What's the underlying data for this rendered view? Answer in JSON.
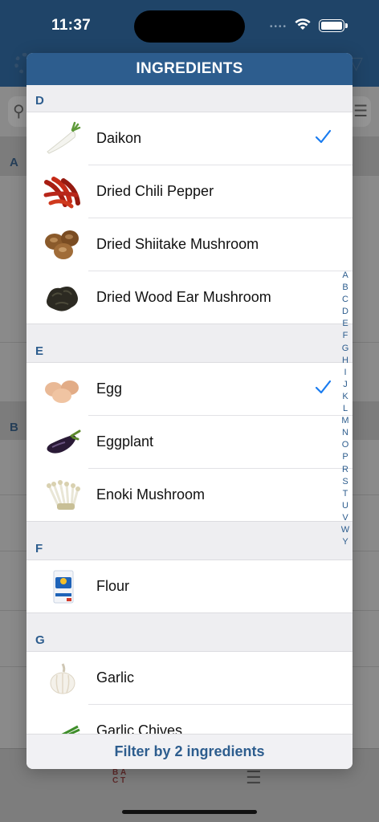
{
  "status": {
    "time": "11:37"
  },
  "background": {
    "sections": [
      "A",
      "B"
    ],
    "tabbar": {
      "abc_icon": "abc-sort-icon",
      "filter_icon": "sliders-icon"
    }
  },
  "modal": {
    "title": "INGREDIENTS",
    "footer_button": "Filter by 2 ingredients"
  },
  "sections": [
    {
      "letter": "D",
      "items": [
        {
          "label": "Daikon",
          "checked": true,
          "icon": "daikon"
        },
        {
          "label": "Dried Chili Pepper",
          "checked": false,
          "icon": "chili"
        },
        {
          "label": "Dried Shiitake Mushroom",
          "checked": false,
          "icon": "shiitake"
        },
        {
          "label": "Dried Wood Ear Mushroom",
          "checked": false,
          "icon": "woodear"
        }
      ]
    },
    {
      "letter": "E",
      "items": [
        {
          "label": "Egg",
          "checked": true,
          "icon": "egg"
        },
        {
          "label": "Eggplant",
          "checked": false,
          "icon": "eggplant"
        },
        {
          "label": "Enoki Mushroom",
          "checked": false,
          "icon": "enoki"
        }
      ]
    },
    {
      "letter": "F",
      "items": [
        {
          "label": "Flour",
          "checked": false,
          "icon": "flour"
        }
      ]
    },
    {
      "letter": "G",
      "items": [
        {
          "label": "Garlic",
          "checked": false,
          "icon": "garlic"
        },
        {
          "label": "Garlic Chives",
          "checked": false,
          "icon": "chives"
        }
      ]
    }
  ],
  "index_letters": [
    "A",
    "B",
    "C",
    "D",
    "E",
    "F",
    "G",
    "H",
    "I",
    "J",
    "K",
    "L",
    "M",
    "N",
    "O",
    "P",
    "R",
    "S",
    "T",
    "U",
    "V",
    "W",
    "Y"
  ],
  "colors": {
    "accent": "#2d5d8e",
    "check": "#1a7cf0"
  }
}
